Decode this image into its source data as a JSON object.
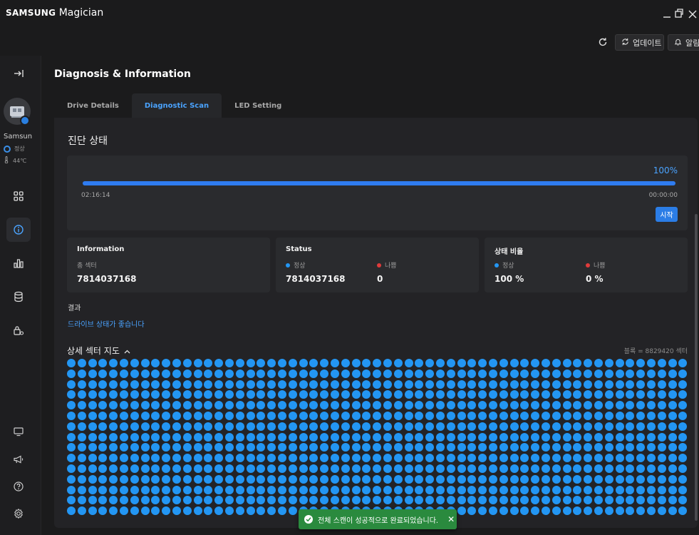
{
  "app": {
    "brand_bold": "SAMSUNG",
    "brand_light": "Magician"
  },
  "toolbar": {
    "update_label": "업데이트",
    "alert_label": "알림"
  },
  "sidebar": {
    "drive_name": "Samsung",
    "drive_status": "정상",
    "drive_temp": "44℃",
    "icons": [
      "collapse-icon",
      "dashboard-icon",
      "info-icon",
      "chart-icon",
      "database-icon",
      "lock-gear-icon",
      "monitor-icon",
      "megaphone-icon",
      "help-icon",
      "settings-icon"
    ]
  },
  "main": {
    "title": "Diagnosis & Information",
    "tabs": [
      {
        "label": "Drive Details",
        "active": false
      },
      {
        "label": "Diagnostic Scan",
        "active": true
      },
      {
        "label": "LED Setting",
        "active": false
      }
    ],
    "section_title": "진단 상태",
    "progress": {
      "percent_label": "100%",
      "value": 1.0,
      "elapsed": "02:16:14",
      "remaining": "00:00:00",
      "start_label": "시작"
    },
    "info_card": {
      "title": "Information",
      "sub": "총 섹터",
      "value": "7814037168"
    },
    "status_card": {
      "title": "Status",
      "good_label": "정상",
      "good_value": "7814037168",
      "bad_label": "나쁨",
      "bad_value": "0"
    },
    "ratio_card": {
      "title": "상태 비율",
      "good_label": "정상",
      "good_value": "100 %",
      "bad_label": "나쁨",
      "bad_value": "0 %"
    },
    "result_label": "결과",
    "result_text": "드라이브 상태가 좋습니다",
    "map_title": "상세 섹터 지도",
    "map_note": "블록 = 8829420 섹터",
    "map": {
      "columns": 59,
      "rows": 15,
      "status": "good"
    }
  },
  "toast": {
    "message": "전체 스캔이 성공적으로 완료되었습니다."
  },
  "colors": {
    "accent": "#4aa3ff",
    "good": "#2396f3",
    "bad": "#e03b3b",
    "toast": "#2a8a3e"
  }
}
